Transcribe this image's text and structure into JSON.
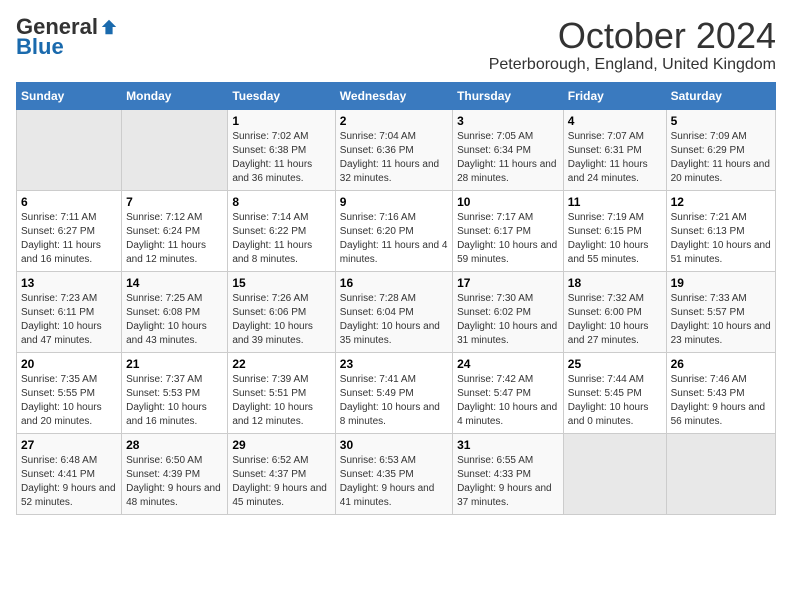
{
  "header": {
    "logo_general": "General",
    "logo_blue": "Blue",
    "month_title": "October 2024",
    "location": "Peterborough, England, United Kingdom"
  },
  "days_of_week": [
    "Sunday",
    "Monday",
    "Tuesday",
    "Wednesday",
    "Thursday",
    "Friday",
    "Saturday"
  ],
  "weeks": [
    [
      {
        "day": "",
        "empty": true
      },
      {
        "day": "",
        "empty": true
      },
      {
        "day": "1",
        "sunrise": "Sunrise: 7:02 AM",
        "sunset": "Sunset: 6:38 PM",
        "daylight": "Daylight: 11 hours and 36 minutes."
      },
      {
        "day": "2",
        "sunrise": "Sunrise: 7:04 AM",
        "sunset": "Sunset: 6:36 PM",
        "daylight": "Daylight: 11 hours and 32 minutes."
      },
      {
        "day": "3",
        "sunrise": "Sunrise: 7:05 AM",
        "sunset": "Sunset: 6:34 PM",
        "daylight": "Daylight: 11 hours and 28 minutes."
      },
      {
        "day": "4",
        "sunrise": "Sunrise: 7:07 AM",
        "sunset": "Sunset: 6:31 PM",
        "daylight": "Daylight: 11 hours and 24 minutes."
      },
      {
        "day": "5",
        "sunrise": "Sunrise: 7:09 AM",
        "sunset": "Sunset: 6:29 PM",
        "daylight": "Daylight: 11 hours and 20 minutes."
      }
    ],
    [
      {
        "day": "6",
        "sunrise": "Sunrise: 7:11 AM",
        "sunset": "Sunset: 6:27 PM",
        "daylight": "Daylight: 11 hours and 16 minutes."
      },
      {
        "day": "7",
        "sunrise": "Sunrise: 7:12 AM",
        "sunset": "Sunset: 6:24 PM",
        "daylight": "Daylight: 11 hours and 12 minutes."
      },
      {
        "day": "8",
        "sunrise": "Sunrise: 7:14 AM",
        "sunset": "Sunset: 6:22 PM",
        "daylight": "Daylight: 11 hours and 8 minutes."
      },
      {
        "day": "9",
        "sunrise": "Sunrise: 7:16 AM",
        "sunset": "Sunset: 6:20 PM",
        "daylight": "Daylight: 11 hours and 4 minutes."
      },
      {
        "day": "10",
        "sunrise": "Sunrise: 7:17 AM",
        "sunset": "Sunset: 6:17 PM",
        "daylight": "Daylight: 10 hours and 59 minutes."
      },
      {
        "day": "11",
        "sunrise": "Sunrise: 7:19 AM",
        "sunset": "Sunset: 6:15 PM",
        "daylight": "Daylight: 10 hours and 55 minutes."
      },
      {
        "day": "12",
        "sunrise": "Sunrise: 7:21 AM",
        "sunset": "Sunset: 6:13 PM",
        "daylight": "Daylight: 10 hours and 51 minutes."
      }
    ],
    [
      {
        "day": "13",
        "sunrise": "Sunrise: 7:23 AM",
        "sunset": "Sunset: 6:11 PM",
        "daylight": "Daylight: 10 hours and 47 minutes."
      },
      {
        "day": "14",
        "sunrise": "Sunrise: 7:25 AM",
        "sunset": "Sunset: 6:08 PM",
        "daylight": "Daylight: 10 hours and 43 minutes."
      },
      {
        "day": "15",
        "sunrise": "Sunrise: 7:26 AM",
        "sunset": "Sunset: 6:06 PM",
        "daylight": "Daylight: 10 hours and 39 minutes."
      },
      {
        "day": "16",
        "sunrise": "Sunrise: 7:28 AM",
        "sunset": "Sunset: 6:04 PM",
        "daylight": "Daylight: 10 hours and 35 minutes."
      },
      {
        "day": "17",
        "sunrise": "Sunrise: 7:30 AM",
        "sunset": "Sunset: 6:02 PM",
        "daylight": "Daylight: 10 hours and 31 minutes."
      },
      {
        "day": "18",
        "sunrise": "Sunrise: 7:32 AM",
        "sunset": "Sunset: 6:00 PM",
        "daylight": "Daylight: 10 hours and 27 minutes."
      },
      {
        "day": "19",
        "sunrise": "Sunrise: 7:33 AM",
        "sunset": "Sunset: 5:57 PM",
        "daylight": "Daylight: 10 hours and 23 minutes."
      }
    ],
    [
      {
        "day": "20",
        "sunrise": "Sunrise: 7:35 AM",
        "sunset": "Sunset: 5:55 PM",
        "daylight": "Daylight: 10 hours and 20 minutes."
      },
      {
        "day": "21",
        "sunrise": "Sunrise: 7:37 AM",
        "sunset": "Sunset: 5:53 PM",
        "daylight": "Daylight: 10 hours and 16 minutes."
      },
      {
        "day": "22",
        "sunrise": "Sunrise: 7:39 AM",
        "sunset": "Sunset: 5:51 PM",
        "daylight": "Daylight: 10 hours and 12 minutes."
      },
      {
        "day": "23",
        "sunrise": "Sunrise: 7:41 AM",
        "sunset": "Sunset: 5:49 PM",
        "daylight": "Daylight: 10 hours and 8 minutes."
      },
      {
        "day": "24",
        "sunrise": "Sunrise: 7:42 AM",
        "sunset": "Sunset: 5:47 PM",
        "daylight": "Daylight: 10 hours and 4 minutes."
      },
      {
        "day": "25",
        "sunrise": "Sunrise: 7:44 AM",
        "sunset": "Sunset: 5:45 PM",
        "daylight": "Daylight: 10 hours and 0 minutes."
      },
      {
        "day": "26",
        "sunrise": "Sunrise: 7:46 AM",
        "sunset": "Sunset: 5:43 PM",
        "daylight": "Daylight: 9 hours and 56 minutes."
      }
    ],
    [
      {
        "day": "27",
        "sunrise": "Sunrise: 6:48 AM",
        "sunset": "Sunset: 4:41 PM",
        "daylight": "Daylight: 9 hours and 52 minutes."
      },
      {
        "day": "28",
        "sunrise": "Sunrise: 6:50 AM",
        "sunset": "Sunset: 4:39 PM",
        "daylight": "Daylight: 9 hours and 48 minutes."
      },
      {
        "day": "29",
        "sunrise": "Sunrise: 6:52 AM",
        "sunset": "Sunset: 4:37 PM",
        "daylight": "Daylight: 9 hours and 45 minutes."
      },
      {
        "day": "30",
        "sunrise": "Sunrise: 6:53 AM",
        "sunset": "Sunset: 4:35 PM",
        "daylight": "Daylight: 9 hours and 41 minutes."
      },
      {
        "day": "31",
        "sunrise": "Sunrise: 6:55 AM",
        "sunset": "Sunset: 4:33 PM",
        "daylight": "Daylight: 9 hours and 37 minutes."
      },
      {
        "day": "",
        "empty": true
      },
      {
        "day": "",
        "empty": true
      }
    ]
  ]
}
